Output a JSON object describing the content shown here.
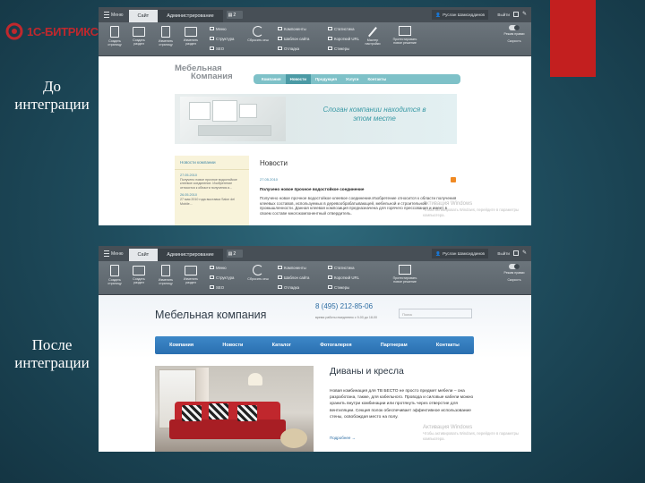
{
  "logo": {
    "text": "1С-БИТРИКС"
  },
  "captions": {
    "before": "До интеграции",
    "after": "После интеграции"
  },
  "admin": {
    "menu": "Меню",
    "tab_site": "Сайт",
    "tab_admin": "Администрирование",
    "badge": "2",
    "user": "Руслан Шамсиддинов",
    "logout": "Выйти",
    "buttons": {
      "create_page": "Создать страницу",
      "create_section": "Создать раздел",
      "edit_page": "Изменить страницу",
      "edit_section": "Изменить раздел",
      "reset_cache": "Сбросить кеш",
      "wizard": "Мастер настройки",
      "preview": "Протестировать новое решение"
    },
    "small": {
      "menu": "Меню",
      "structure": "Структура",
      "seo": "SEO",
      "components": "Компоненты",
      "site_template": "Шаблон сайта",
      "debug": "Отладка",
      "stats": "Статистика",
      "cache_url": "Короткий URL",
      "stickers": "Стикеры"
    },
    "edit_mode": "Режим правки",
    "speed": "Скорость"
  },
  "site1": {
    "logo_line1": "Мебельная",
    "logo_line2": "Компания",
    "nav": [
      "Компания",
      "Новости",
      "Продукция",
      "Услуги",
      "Контакты"
    ],
    "slogan": "Слоган компании находится в этом месте",
    "sidebar_title": "Новости компании",
    "sidebar_items": [
      {
        "date": "27.05.2010",
        "text": "Получено новое прочное водостойкое клеевое соединение. Изобретение относится к области получения и..."
      },
      {
        "date": "26.05.2010",
        "text": "27 мая 2010 года выставка Salon del Mobile..."
      }
    ],
    "news_heading": "Новости",
    "news_date": "27.05.2010",
    "news_title": "Получено новое прочное водостойкое соединение",
    "news_body": "Получено новое прочное водостойкое клеевое соединение.Изобретение относится к области получения клеевых составов, используемых в деревообрабатывающей, мебельной и строительной промышленности. Данная клеевая композиция предназначена для горячего прессования и имеет в своем составе многокомпонентный отвердитель.",
    "watermark": "Активация Windows",
    "watermark_sub": "Чтобы активировать Windows, перейдите в параметры компьютера."
  },
  "site2": {
    "title": "Мебельная компания",
    "phone": "8 (495) 212-85-06",
    "hours": "время работы ежедневно с 9-00 до 18-00",
    "search_placeholder": "Поиск",
    "nav": [
      "Компания",
      "Новости",
      "Каталог",
      "Фотогалерея",
      "Партнерам",
      "Контакты"
    ],
    "heading": "Диваны и кресла",
    "body": "Новая комбинация для ТВ БЕСТО не просто предмет мебели – она разработана, также, для кабельного. Провода и силовые кабели можно хранить внутри комбинации или протянуть через отверстие для вентиляции. Секция полок обеспечивает эффективное использование стены, освобождая место на полу.",
    "more": "Подробнее →",
    "watermark": "Активация Windows",
    "watermark_sub": "Чтобы активировать Windows, перейдите в параметры компьютера."
  },
  "colors": {
    "accent_red": "#c31f1f",
    "admin_bg": "#474f56",
    "nav_blue": "#2a6fb0",
    "nav_teal": "#7ec1c8"
  }
}
